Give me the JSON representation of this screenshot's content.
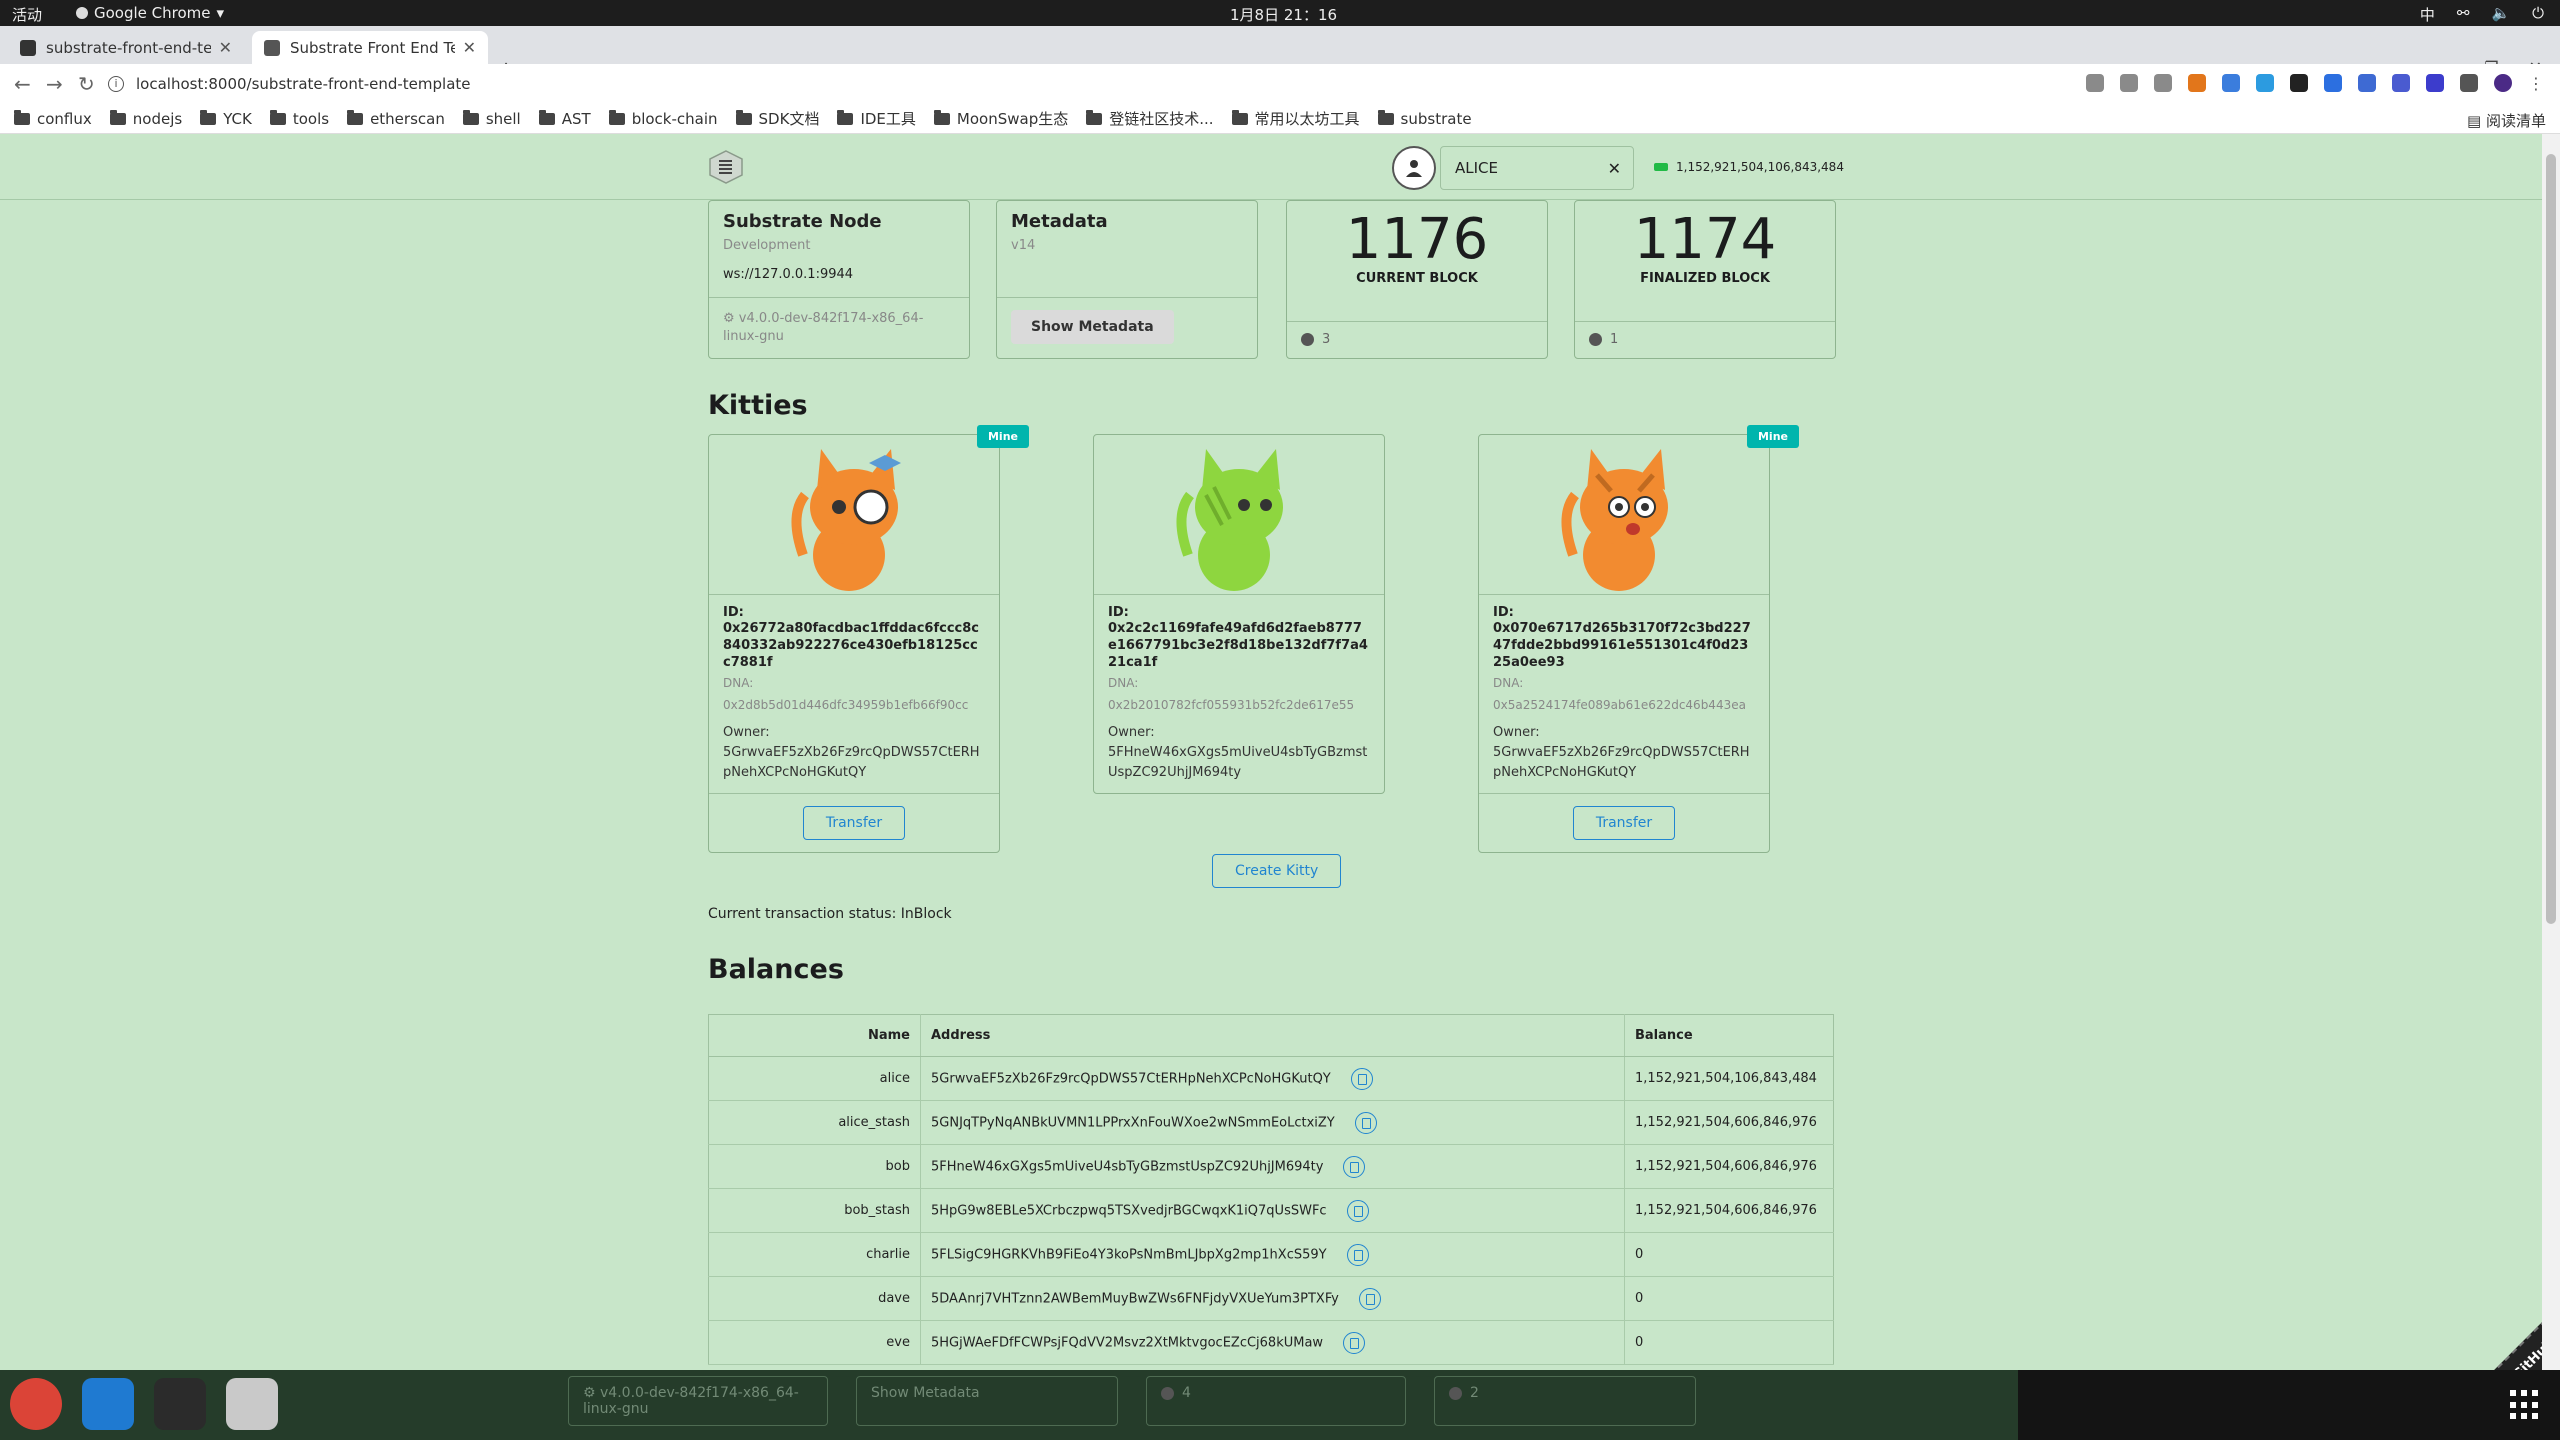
{
  "os": {
    "activities": "活动",
    "app_name": "Google Chrome",
    "datetime": "1月8日 21：16",
    "input_method": "中"
  },
  "browser": {
    "tabs": [
      {
        "title": "substrate-front-end-temp",
        "active": false
      },
      {
        "title": "Substrate Front End Tem",
        "active": true
      }
    ],
    "url": "localhost:8000/substrate-front-end-template",
    "bookmarks": [
      "conflux",
      "nodejs",
      "YCK",
      "tools",
      "etherscan",
      "shell",
      "AST",
      "block-chain",
      "SDK文档",
      "IDE工具",
      "MoonSwap生态",
      "登链社区技术...",
      "常用以太坊工具",
      "substrate"
    ],
    "reading_list": "阅读清单"
  },
  "header": {
    "account_name": "ALICE",
    "account_balance": "1,152,921,504,106,843,484"
  },
  "node_info": {
    "title": "Substrate Node",
    "chain": "Development",
    "socket": "ws://127.0.0.1:9944",
    "version": "v4.0.0-dev-842f174-x86_64-linux-gnu"
  },
  "metadata": {
    "title": "Metadata",
    "version": "v14",
    "button": "Show Metadata"
  },
  "blocks": [
    {
      "number": "1176",
      "label": "CURRENT BLOCK",
      "timer": "3"
    },
    {
      "number": "1174",
      "label": "FINALIZED BLOCK",
      "timer": "1"
    }
  ],
  "kitties_section": {
    "title": "Kitties",
    "id_label": "ID:",
    "dna_label": "DNA:",
    "owner_label": "Owner:",
    "mine_label": "Mine",
    "transfer_label": "Transfer",
    "kitties": [
      {
        "id": "0x26772a80facdbac1ffddac6fccc8c840332ab922276ce430efb18125ccc7881f",
        "dna": "0x2d8b5d01d446dfc34959b1efb66f90cc",
        "owner": "5GrwvaEF5zXb26Fz9rcQpDWS57CtERHpNehXCPcNoHGKutQY",
        "mine": true,
        "color": "#f28b30"
      },
      {
        "id": "0x2c2c1169fafe49afd6d2faeb8777e1667791bc3e2f8d18be132df7f7a421ca1f",
        "dna": "0x2b2010782fcf055931b52fc2de617e55",
        "owner": "5FHneW46xGXgs5mUiveU4sbTyGBzmstUspZC92UhjJM694ty",
        "mine": false,
        "color": "#8ed63f"
      },
      {
        "id": "0x070e6717d265b3170f72c3bd22747fdde2bbd99161e551301c4f0d2325a0ee93",
        "dna": "0x5a2524174fe089ab61e622dc46b443ea",
        "owner": "5GrwvaEF5zXb26Fz9rcQpDWS57CtERHpNehXCPcNoHGKutQY",
        "mine": true,
        "color": "#f28b30"
      }
    ],
    "create_button": "Create Kitty",
    "status": "Current transaction status: InBlock"
  },
  "balances": {
    "title": "Balances",
    "headers": {
      "name": "Name",
      "address": "Address",
      "balance": "Balance"
    },
    "rows": [
      {
        "name": "alice",
        "address": "5GrwvaEF5zXb26Fz9rcQpDWS57CtERHpNehXCPcNoHGKutQY",
        "balance": "1,152,921,504,106,843,484"
      },
      {
        "name": "alice_stash",
        "address": "5GNJqTPyNqANBkUVMN1LPPrxXnFouWXoe2wNSmmEoLctxiZY",
        "balance": "1,152,921,504,606,846,976"
      },
      {
        "name": "bob",
        "address": "5FHneW46xGXgs5mUiveU4sbTyGBzmstUspZC92UhjJM694ty",
        "balance": "1,152,921,504,606,846,976"
      },
      {
        "name": "bob_stash",
        "address": "5HpG9w8EBLe5XCrbczpwq5TSXvedjrBGCwqxK1iQ7qUsSWFc",
        "balance": "1,152,921,504,606,846,976"
      },
      {
        "name": "charlie",
        "address": "5FLSigC9HGRKVhB9FiEo4Y3koPsNmBmLJbpXg2mp1hXcS59Y",
        "balance": "0"
      },
      {
        "name": "dave",
        "address": "5DAAnrj7VHTznn2AWBemMuyBwZWs6FNFjdyVXUeYum3PTXFy",
        "balance": "0"
      },
      {
        "name": "eve",
        "address": "5HGjWAeFDfFCWPsjFQdVV2Msvz2XtMktvgocEZcCj68kUMaw",
        "balance": "0"
      }
    ]
  },
  "github_ribbon": "Fork me on GitHub",
  "dock_ghost": {
    "version": "v4.0.0-dev-842f174-x86_64-linux-gnu",
    "button": "Show Metadata",
    "timer1": "4",
    "timer2": "2"
  }
}
